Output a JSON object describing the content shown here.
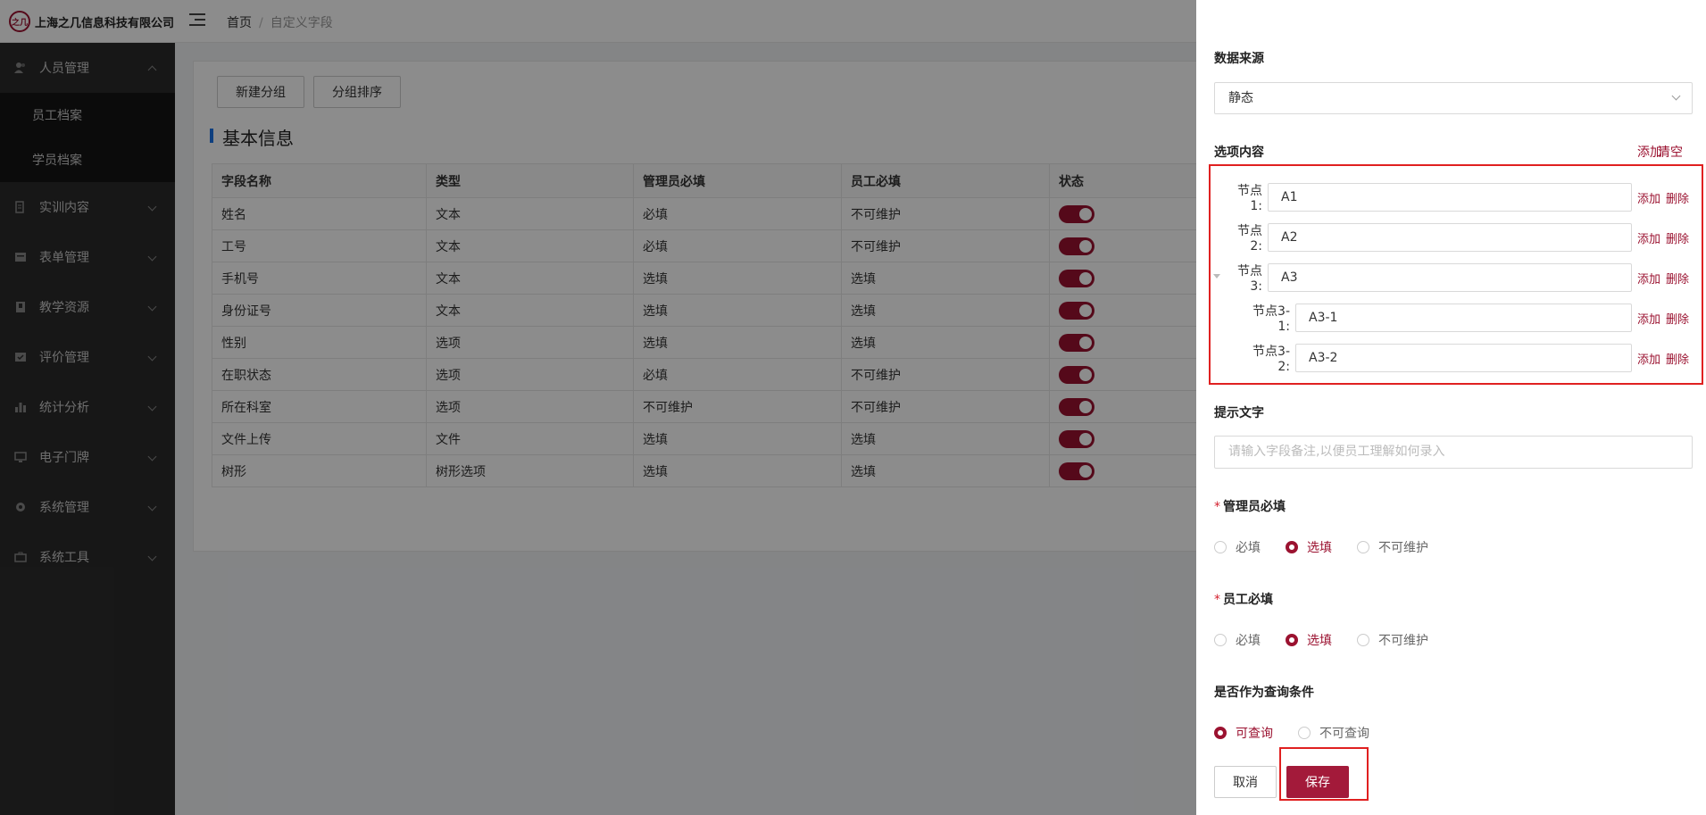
{
  "header": {
    "logo_text": "之几",
    "company": "上海之几信息科技有限公司",
    "breadcrumb": [
      "首页",
      "自定义字段"
    ]
  },
  "sidebar": {
    "items": [
      {
        "label": "人员管理",
        "icon": "users-icon",
        "expanded": true,
        "children": [
          "员工档案",
          "学员档案"
        ]
      },
      {
        "label": "实训内容",
        "icon": "training-icon"
      },
      {
        "label": "表单管理",
        "icon": "form-icon"
      },
      {
        "label": "教学资源",
        "icon": "book-icon"
      },
      {
        "label": "评价管理",
        "icon": "evaluation-icon"
      },
      {
        "label": "统计分析",
        "icon": "bar-chart-icon"
      },
      {
        "label": "电子门牌",
        "icon": "monitor-icon"
      },
      {
        "label": "系统管理",
        "icon": "gear-icon"
      },
      {
        "label": "系统工具",
        "icon": "toolbox-icon"
      }
    ]
  },
  "main": {
    "buttons": {
      "new_group": "新建分组",
      "sort_group": "分组排序"
    },
    "section_title": "基本信息",
    "table": {
      "columns": [
        "字段名称",
        "类型",
        "管理员必填",
        "员工必填",
        "状态"
      ],
      "rows": [
        [
          "姓名",
          "文本",
          "必填",
          "不可维护"
        ],
        [
          "工号",
          "文本",
          "必填",
          "不可维护"
        ],
        [
          "手机号",
          "文本",
          "选填",
          "选填"
        ],
        [
          "身份证号",
          "文本",
          "选填",
          "选填"
        ],
        [
          "性别",
          "选项",
          "选填",
          "选填"
        ],
        [
          "在职状态",
          "选项",
          "必填",
          "不可维护"
        ],
        [
          "所在科室",
          "选项",
          "不可维护",
          "不可维护"
        ],
        [
          "文件上传",
          "文件",
          "选填",
          "选填"
        ],
        [
          "树形",
          "树形选项",
          "选填",
          "选填"
        ]
      ]
    }
  },
  "drawer": {
    "data_source_label": "数据来源",
    "data_source_value": "静态",
    "options_label": "选项内容",
    "options_add": "添加",
    "options_clear": "清空",
    "nodes": [
      {
        "label": "节点1:",
        "value": "A1"
      },
      {
        "label": "节点2:",
        "value": "A2"
      },
      {
        "label": "节点3:",
        "value": "A3"
      },
      {
        "label": "节点3-1:",
        "value": "A3-1"
      },
      {
        "label": "节点3-2:",
        "value": "A3-2"
      }
    ],
    "node_add": "添加",
    "node_delete": "删除",
    "hint_label": "提示文字",
    "hint_placeholder": "请输入字段备注,以便员工理解如何录入",
    "admin_required_label": "管理员必填",
    "admin_required_options": [
      "必填",
      "选填",
      "不可维护"
    ],
    "admin_required_selected": "选填",
    "staff_required_label": "员工必填",
    "staff_required_options": [
      "必填",
      "选填",
      "不可维护"
    ],
    "staff_required_selected": "选填",
    "query_label": "是否作为查询条件",
    "query_options": [
      "可查询",
      "不可查询"
    ],
    "query_selected": "可查询",
    "cancel": "取消",
    "save": "保存"
  },
  "colors": {
    "accent": "#9b1230",
    "sidebar": "#2b2b2b",
    "highlight_box": "#e02020"
  }
}
